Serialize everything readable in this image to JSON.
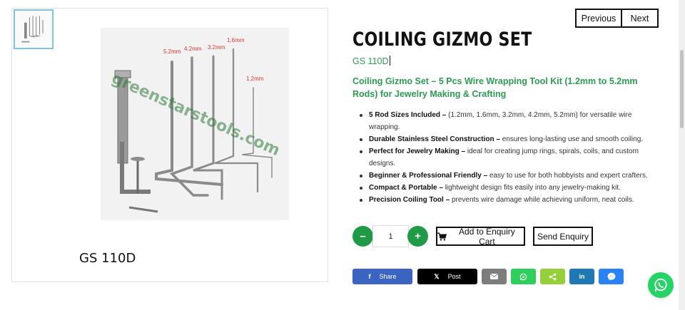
{
  "gallery": {
    "thumbnail_alt": "GS 110D thumbnail",
    "watermark": "greenstarstools.com",
    "rod_labels": [
      "5.2mm",
      "4.2mm",
      "3.2mm",
      "1.6mm",
      "1.2mm"
    ],
    "caption": "GS 110D"
  },
  "pager": {
    "previous": "Previous",
    "next": "Next"
  },
  "product": {
    "title": "COILING GIZMO SET",
    "sku": "GS 110D",
    "subtitle": "Coiling Gizmo Set – 5 Pcs Wire Wrapping Tool Kit (1.2mm to 5.2mm Rods) for Jewelry Making & Crafting",
    "features": [
      {
        "bold": "5 Rod Sizes Included –",
        "text": " (1.2mm, 1.6mm, 3.2mm, 4.2mm, 5.2mm) for versatile wire wrapping."
      },
      {
        "bold": "Durable Stainless Steel Construction –",
        "text": " ensures long-lasting use and smooth coiling."
      },
      {
        "bold": "Perfect for Jewelry Making –",
        "text": " ideal for creating jump rings, spirals, coils, and custom designs."
      },
      {
        "bold": "Beginner & Professional Friendly –",
        "text": " easy to use for both hobbyists and expert crafters."
      },
      {
        "bold": "Compact & Portable –",
        "text": " lightweight design fits easily into any jewelry-making kit."
      },
      {
        "bold": "Precision Coiling Tool –",
        "text": " prevents wire damage while achieving uniform, neat coils."
      }
    ]
  },
  "quantity": {
    "minus": "–",
    "plus": "+",
    "value": "1"
  },
  "actions": {
    "add_to_cart": "Add to Enquiry Cart",
    "send_enquiry": "Send Enquiry"
  },
  "share": {
    "facebook": "Share",
    "x": "Post"
  },
  "colors": {
    "accent": "#2d9c53",
    "button_green": "#1f9b48",
    "facebook": "#3b63c2",
    "whatsapp": "#25d366"
  }
}
